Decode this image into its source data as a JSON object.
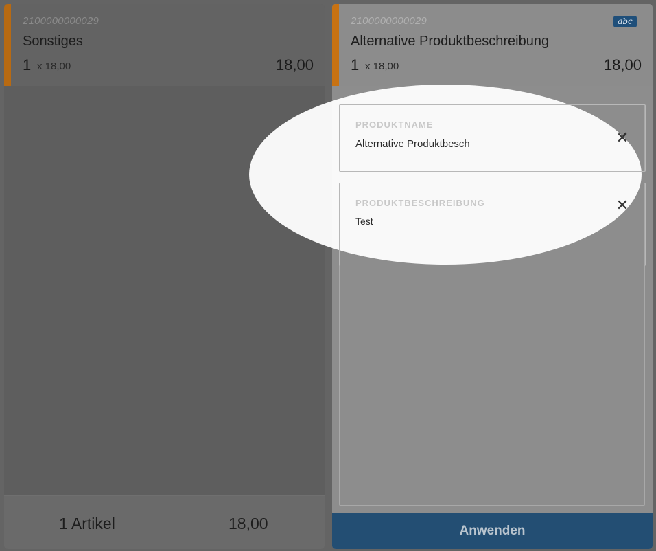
{
  "left_panel": {
    "item": {
      "barcode": "2100000000029",
      "name": "Sonstiges",
      "quantity": "1",
      "unit_price": "x 18,00",
      "line_total": "18,00",
      "accent_color": "#c87212"
    },
    "summary": {
      "count": "1 Artikel",
      "total": "18,00"
    }
  },
  "right_panel": {
    "item": {
      "barcode": "2100000000029",
      "name": "Alternative Produktbeschreibung",
      "quantity": "1",
      "unit_price": "x 18,00",
      "line_total": "18,00",
      "badge": "abc",
      "accent_color": "#c87212"
    },
    "fields": {
      "product_name": {
        "label": "PRODUKTNAME",
        "value": "Alternative Produktbesch",
        "clear_icon": "close-icon"
      },
      "product_description": {
        "label": "PRODUKTBESCHREIBUNG",
        "value": "Test",
        "clear_icon": "close-icon"
      }
    },
    "apply_label": "Anwenden"
  },
  "colors": {
    "accent": "#c87212",
    "primary": "#234e73",
    "badge": "#1f4f7a"
  }
}
